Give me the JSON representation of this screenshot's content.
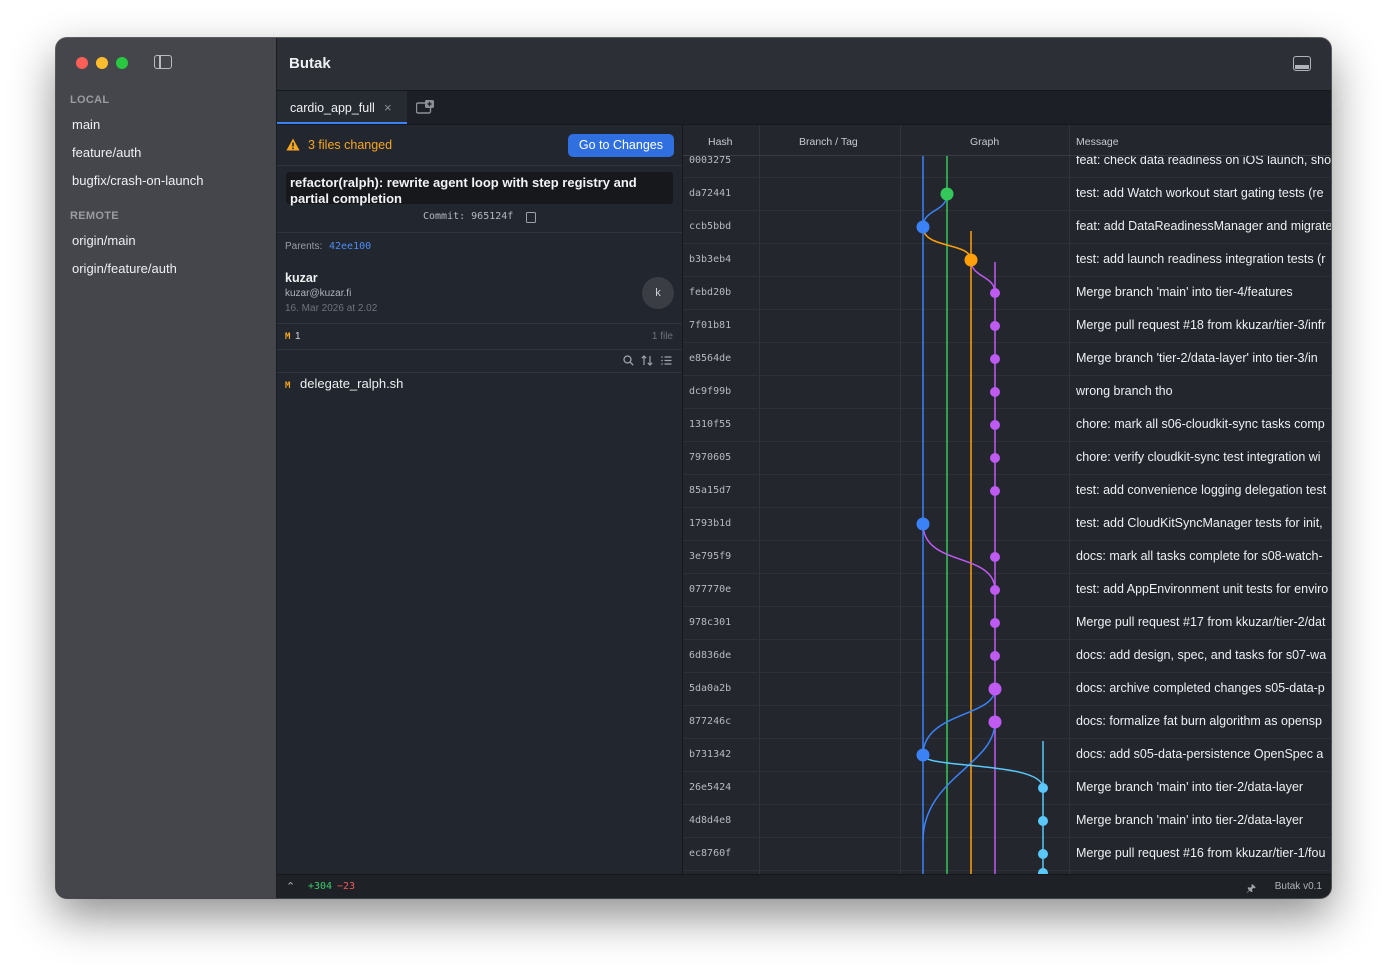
{
  "window": {
    "title": "Butak",
    "traffic_lights": [
      "#ff5f57",
      "#febc2e",
      "#28c840"
    ]
  },
  "sidebar": {
    "local_label": "LOCAL",
    "local": [
      "main",
      "feature/auth",
      "bugfix/crash-on-launch"
    ],
    "remote_label": "REMOTE",
    "remote": [
      "origin/main",
      "origin/feature/auth"
    ]
  },
  "tabs": [
    {
      "label": "cardio_app_full",
      "close": "×"
    }
  ],
  "details": {
    "changed_files": "3 files changed",
    "goto_button": "Go to Changes",
    "commit_message": "refactor(ralph): rewrite agent loop with step registry and partial completion",
    "commit_hash": "Commit: 965124f",
    "parents_label": "Parents:",
    "parents_hash": "42ee100",
    "author": "kuzar",
    "email": "kuzar@kuzar.fi",
    "date": "16. Mar 2026 at 2.02",
    "avatar": "k",
    "mod_letter": "M",
    "mod_count": "1",
    "file_count": "1 file",
    "files": [
      {
        "status": "M",
        "name": "delegate_ralph.sh"
      }
    ]
  },
  "graph": {
    "columns": {
      "hash": "Hash",
      "branch": "Branch / Tag",
      "graph": "Graph",
      "message": "Message"
    },
    "lane_colors": [
      "#3b82f6",
      "#34c759",
      "#ff9f0a",
      "#bf5af2",
      "#5ac8fa"
    ],
    "commits": [
      {
        "hash": "0003275",
        "message": "feat: check data readiness on iOS launch, sho"
      },
      {
        "hash": "da72441",
        "message": "test: add Watch workout start gating tests (re"
      },
      {
        "hash": "ccb5bbd",
        "message": "feat: add DataReadinessManager and migrate"
      },
      {
        "hash": "b3b3eb4",
        "message": "test: add launch readiness integration tests (r"
      },
      {
        "hash": "febd20b",
        "message": "Merge branch 'main' into tier-4/features"
      },
      {
        "hash": "7f01b81",
        "message": "Merge pull request #18 from kkuzar/tier-3/infr"
      },
      {
        "hash": "e8564de",
        "message": "Merge branch 'tier-2/data-layer' into tier-3/in"
      },
      {
        "hash": "dc9f99b",
        "message": "wrong branch tho"
      },
      {
        "hash": "1310f55",
        "message": "chore: mark all s06-cloudkit-sync tasks comp"
      },
      {
        "hash": "7970605",
        "message": "chore: verify cloudkit-sync test integration wi"
      },
      {
        "hash": "85a15d7",
        "message": "test: add convenience logging delegation test"
      },
      {
        "hash": "1793b1d",
        "message": "test: add CloudKitSyncManager tests for init,"
      },
      {
        "hash": "3e795f9",
        "message": "docs: mark all tasks complete for s08-watch-"
      },
      {
        "hash": "077770e",
        "message": "test: add AppEnvironment unit tests for enviro"
      },
      {
        "hash": "978c301",
        "message": "Merge pull request #17 from kkuzar/tier-2/dat"
      },
      {
        "hash": "6d836de",
        "message": "docs: add design, spec, and tasks for s07-wa"
      },
      {
        "hash": "5da0a2b",
        "message": "docs: archive completed changes s05-data-p"
      },
      {
        "hash": "877246c",
        "message": "docs: formalize fat burn algorithm as opensp"
      },
      {
        "hash": "b731342",
        "message": "docs: add s05-data-persistence OpenSpec a"
      },
      {
        "hash": "26e5424",
        "message": "Merge branch 'main' into tier-2/data-layer"
      },
      {
        "hash": "4d8d4e8",
        "message": "Merge branch 'main' into tier-2/data-layer"
      },
      {
        "hash": "ec8760f",
        "message": "Merge pull request #16 from kkuzar/tier-1/fou"
      }
    ]
  },
  "status": {
    "additions": "+304",
    "deletions": "−23",
    "version": "Butak v0.1"
  }
}
